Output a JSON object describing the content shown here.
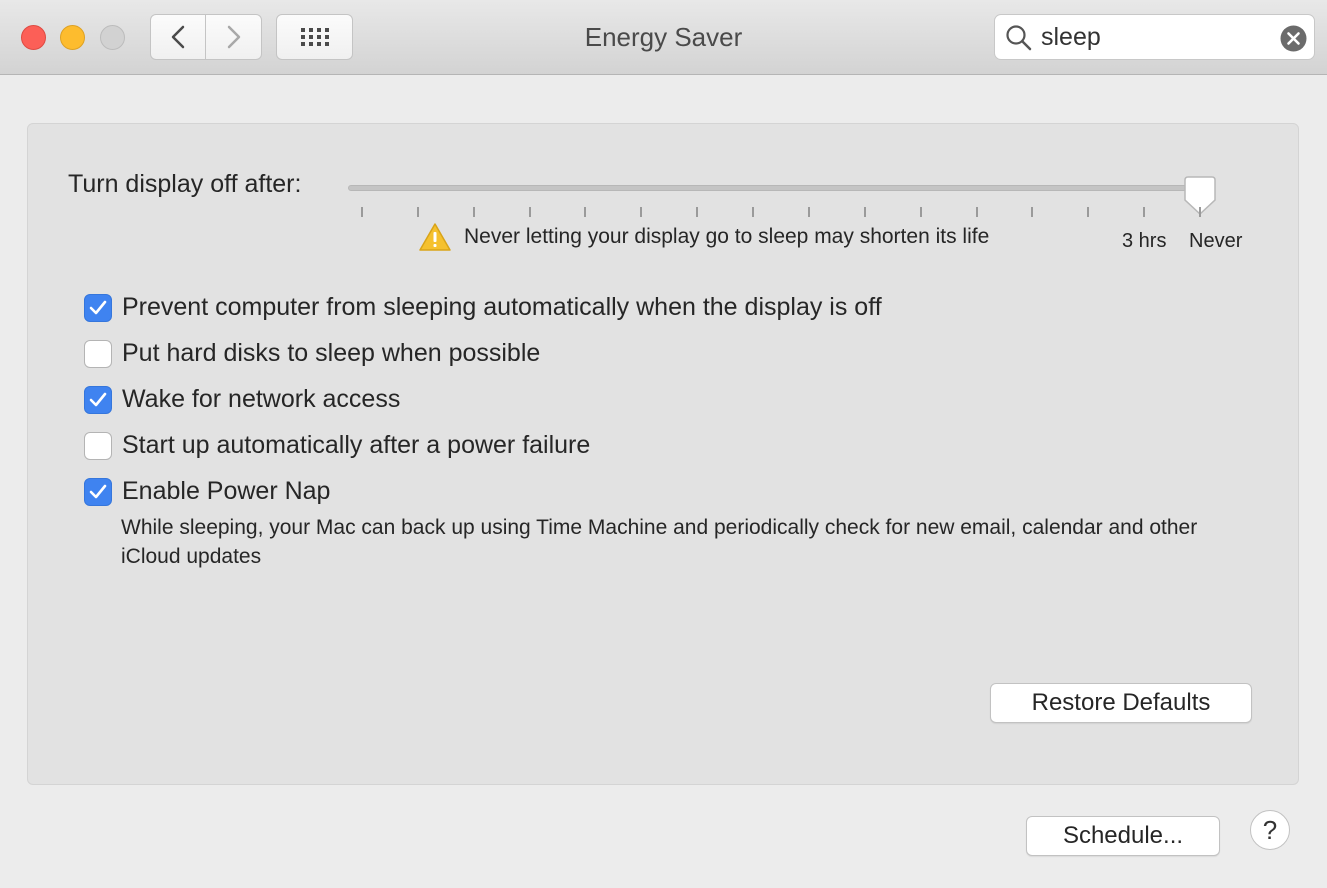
{
  "window": {
    "title": "Energy Saver"
  },
  "toolbar": {
    "back_icon": "chevron-left-icon",
    "forward_icon": "chevron-right-icon",
    "show_all_icon": "grid-icon"
  },
  "search": {
    "value": "sleep",
    "placeholder": "Search"
  },
  "display_sleep": {
    "label": "Turn display off after:",
    "value": "Never",
    "tick_labels": [
      "3 hrs",
      "Never"
    ],
    "warning": "Never letting your display go to sleep may shorten its life"
  },
  "options": [
    {
      "label": "Prevent computer from sleeping automatically when the display is off",
      "checked": true
    },
    {
      "label": "Put hard disks to sleep when possible",
      "checked": false
    },
    {
      "label": "Wake for network access",
      "checked": true
    },
    {
      "label": "Start up automatically after a power failure",
      "checked": false
    },
    {
      "label": "Enable Power Nap",
      "checked": true
    }
  ],
  "power_nap_description": "While sleeping, your Mac can back up using Time Machine and periodically check for new email, calendar and other iCloud updates",
  "buttons": {
    "restore_defaults": "Restore Defaults",
    "schedule": "Schedule...",
    "help": "?"
  },
  "colors": {
    "accent": "#3f83f0",
    "close": "#fc5f57",
    "minimize": "#fdbc2e",
    "warning": "#f5c12e"
  }
}
